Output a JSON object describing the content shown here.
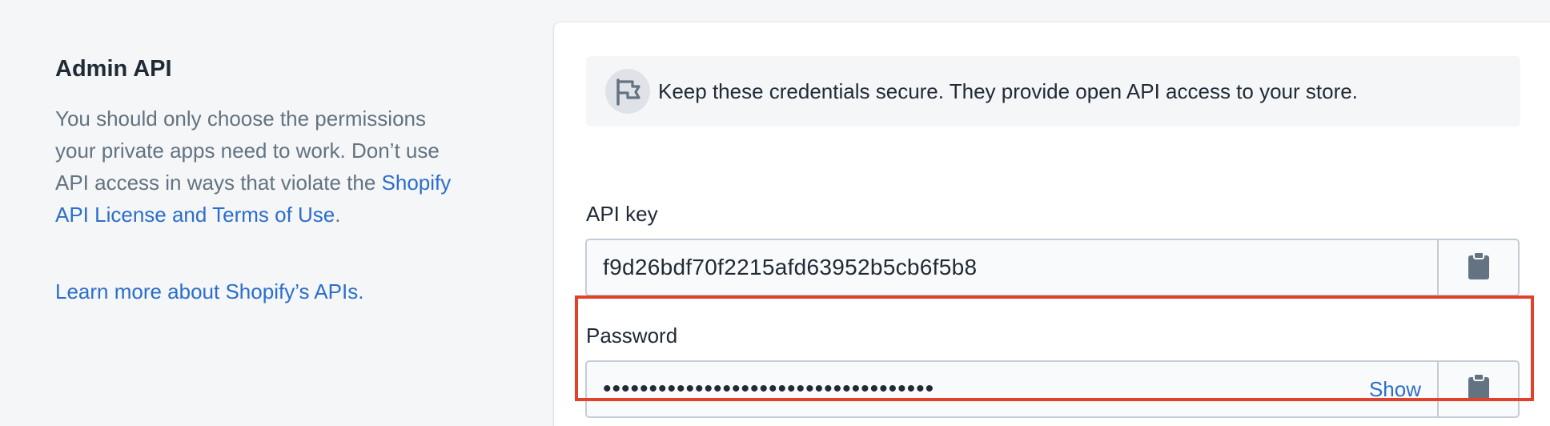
{
  "annotation": {
    "title": "Admin API",
    "description_prefix": "You should only choose the permissions your private apps need to work. Don’t use API access in ways that violate the ",
    "license_link": "Shopify API License and Terms of Use",
    "description_suffix": ".",
    "learn_more_link": "Learn more about Shopify’s APIs."
  },
  "banner": {
    "icon": "flag-icon",
    "text": "Keep these credentials secure. They provide open API access to your store."
  },
  "api_key": {
    "label": "API key",
    "value": "f9d26bdf70f2215afd63952b5cb6f5b8",
    "copy_icon": "clipboard-icon"
  },
  "password": {
    "label": "Password",
    "masked_value": "••••••••••••••••••••••••••••••••••••",
    "show_label": "Show",
    "copy_icon": "clipboard-icon"
  },
  "colors": {
    "link": "#2c6ecb",
    "highlight_border": "#e2412a",
    "background": "#f4f6f8"
  }
}
